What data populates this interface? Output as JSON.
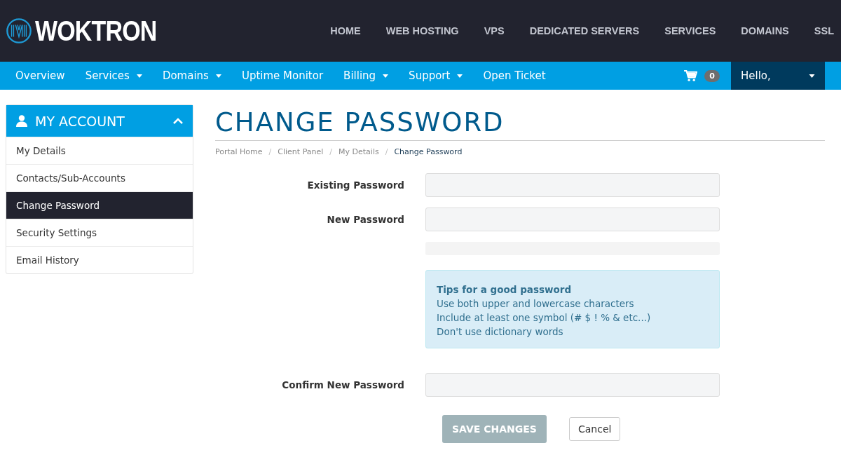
{
  "brand": {
    "name": "WOKTRON"
  },
  "top_menu": [
    "HOME",
    "WEB HOSTING",
    "VPS",
    "DEDICATED SERVERS",
    "SERVICES",
    "DOMAINS",
    "SSL"
  ],
  "nav": [
    {
      "label": "Overview",
      "dropdown": false
    },
    {
      "label": "Services",
      "dropdown": true
    },
    {
      "label": "Domains",
      "dropdown": true
    },
    {
      "label": "Uptime Monitor",
      "dropdown": false
    },
    {
      "label": "Billing",
      "dropdown": true
    },
    {
      "label": "Support",
      "dropdown": true
    },
    {
      "label": "Open Ticket",
      "dropdown": false
    }
  ],
  "cart": {
    "count": "0"
  },
  "user_menu": {
    "label": "Hello,"
  },
  "sidebar": {
    "title": "MY ACCOUNT",
    "expanded": true,
    "items": [
      {
        "label": "My Details",
        "selected": false
      },
      {
        "label": "Contacts/Sub-Accounts",
        "selected": false
      },
      {
        "label": "Change Password",
        "selected": true
      },
      {
        "label": "Security Settings",
        "selected": false
      },
      {
        "label": "Email History",
        "selected": false
      }
    ]
  },
  "page_title": "CHANGE PASSWORD",
  "breadcrumb": [
    {
      "kind": "link",
      "text": "Portal Home"
    },
    {
      "kind": "separator",
      "text": "/"
    },
    {
      "kind": "link",
      "text": "Client Panel"
    },
    {
      "kind": "separator",
      "text": "/"
    },
    {
      "kind": "link",
      "text": "My Details"
    },
    {
      "kind": "separator",
      "text": "/"
    },
    {
      "kind": "current",
      "text": "Change Password"
    }
  ],
  "fields": [
    {
      "kind": "input",
      "label": "Existing Password"
    },
    {
      "kind": "input",
      "label": "New Password"
    },
    {
      "kind": "meter",
      "level": 0
    },
    {
      "kind": "tips",
      "title": "Tips for a good password",
      "lines": [
        "Use both upper and lowercase characters",
        "Include at least one symbol (# $ ! % & etc...)",
        "Don't use dictionary words"
      ]
    },
    {
      "kind": "input",
      "label": "Confirm New Password"
    }
  ],
  "buttons": [
    {
      "label": "SAVE CHANGES",
      "kind": "primary",
      "disabled": true
    },
    {
      "label": "Cancel",
      "kind": "default",
      "disabled": false
    }
  ]
}
